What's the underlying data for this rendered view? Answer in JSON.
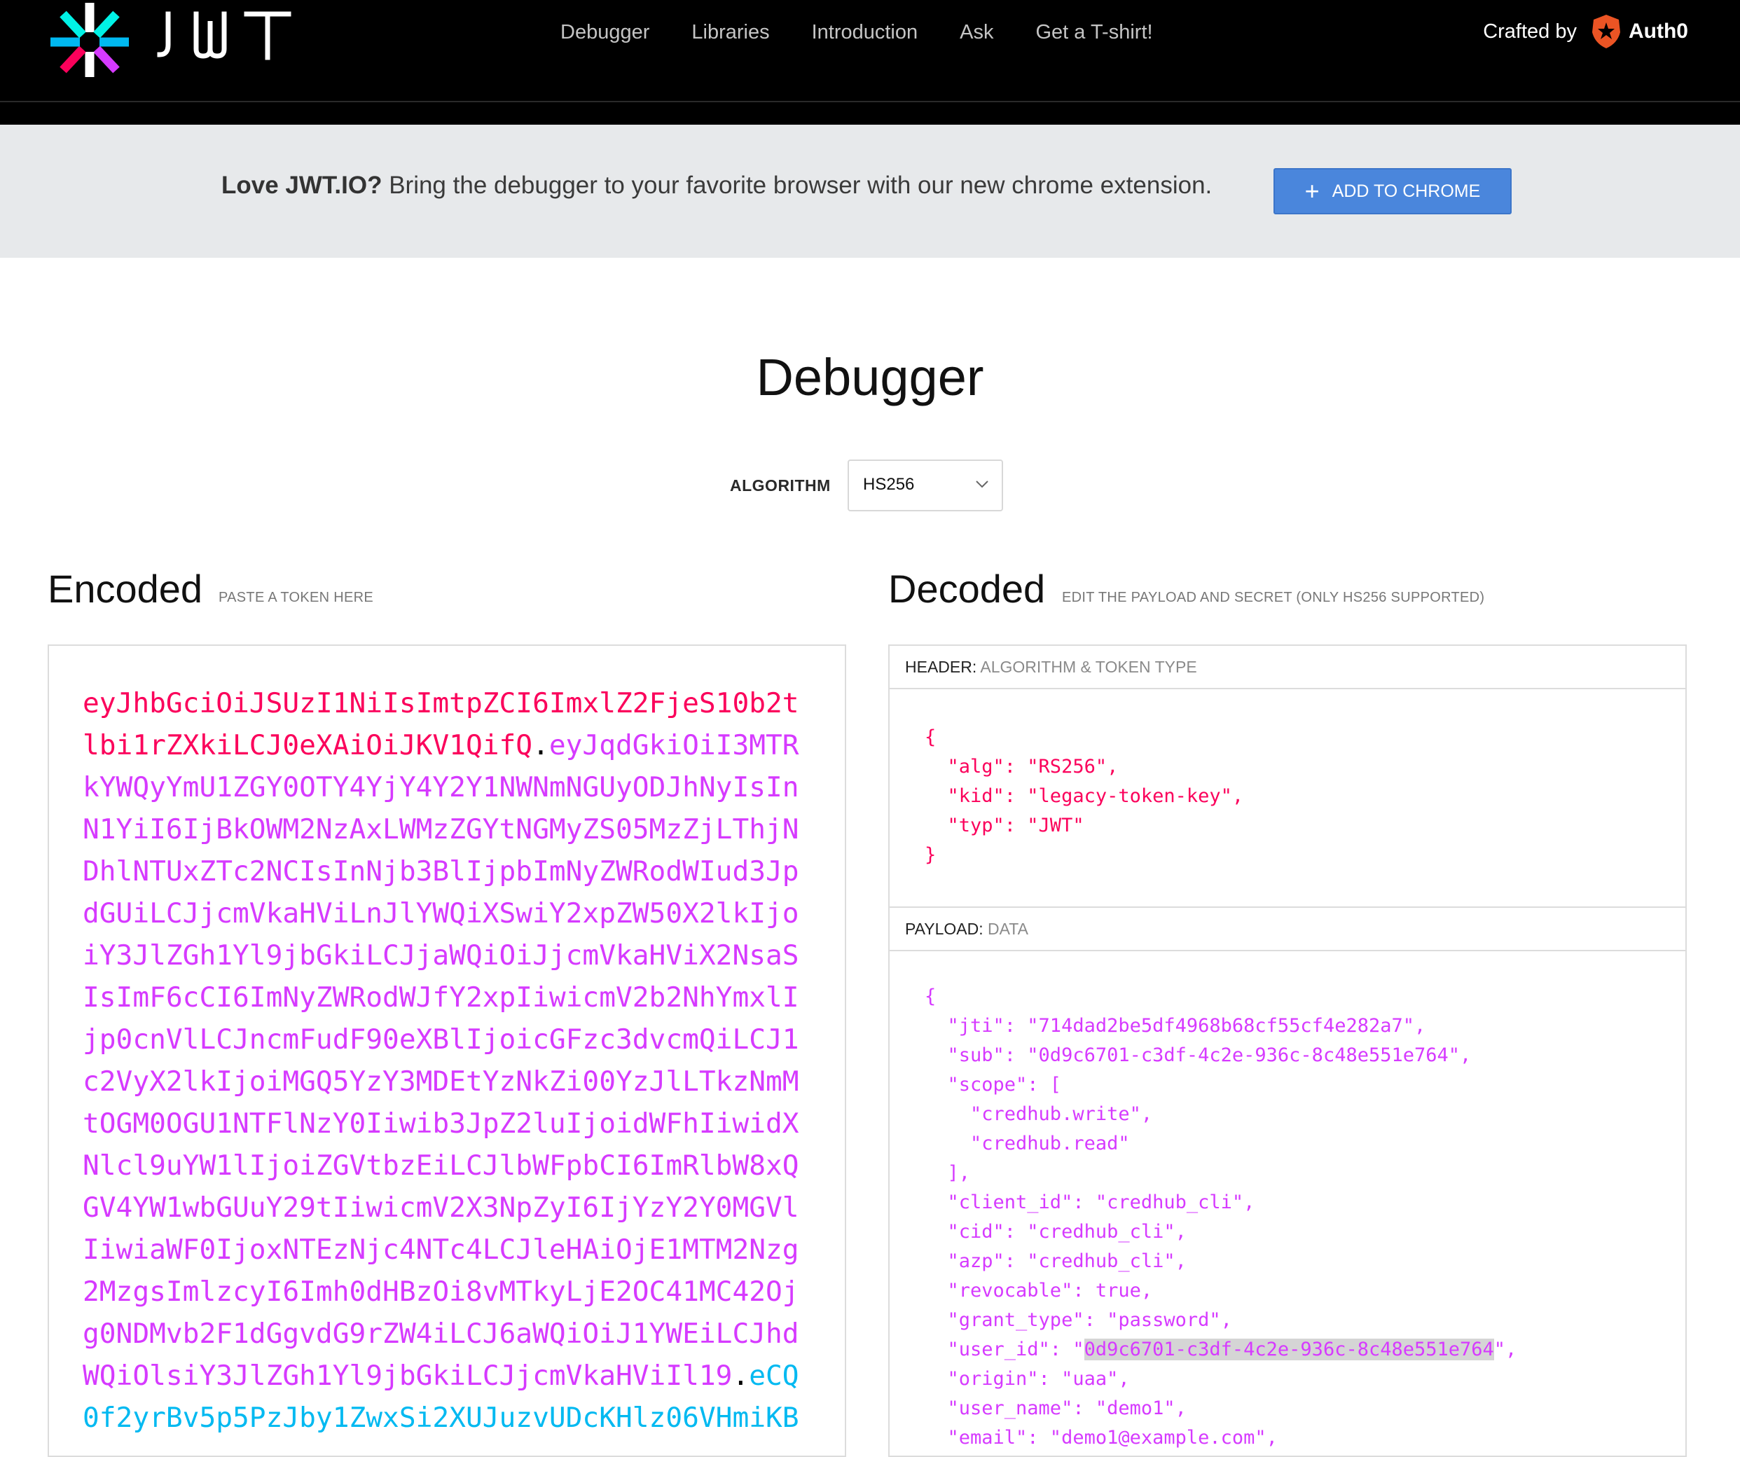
{
  "nav": {
    "brand": "JWT",
    "links": [
      "Debugger",
      "Libraries",
      "Introduction",
      "Ask",
      "Get a T-shirt!"
    ],
    "crafted_by": "Crafted by",
    "crafted_brand": "Auth0"
  },
  "banner": {
    "lead": "Love JWT.IO?",
    "text": " Bring the debugger to your favorite browser with our new chrome extension.",
    "button": "ADD TO CHROME",
    "button_icon": "plus-icon"
  },
  "page": {
    "title": "Debugger",
    "algorithm_label": "ALGORITHM",
    "algorithm_value": "HS256"
  },
  "encoded": {
    "title": "Encoded",
    "subtitle": "PASTE A TOKEN HERE",
    "header_part": "eyJhbGciOiJSUzI1NiIsImtpZCI6ImxlZ2FjeS10b2tlbi1rZXkiLCJ0eXAiOiJKV1QifQ",
    "payload_part": "eyJqdGkiOiI3MTRkYWQyYmU1ZGY0OTY4YjY4Y2Y1NWNmNGUyODJhNyIsInN1YiI6IjBkOWM2NzAxLWMzZGYtNGMyZS05MzZjLThjNDhlNTUxZTc2NCIsInNjb3BlIjpbImNyZWRodWIud3JpdGUiLCJjcmVkaHViLnJlYWQiXSwiY2xpZW50X2lkIjoiY3JlZGh1Yl9jbGkiLCJjaWQiOiJjcmVkaHViX2NsaSIsImF6cCI6ImNyZWRodWJfY2xpIiwicmV2b2NhYmxlIjp0cnVlLCJncmFudF90eXBlIjoicGFzc3dvcmQiLCJ1c2VyX2lkIjoiMGQ5YzY3MDEtYzNkZi00YzJlLTkzNmMtOGM0OGU1NTFlNzY0Iiwib3JpZ2luIjoidWFhIiwidXNlcl9uYW1lIjoiZGVtbzEiLCJlbWFpbCI6ImRlbW8xQGV4YW1wbGUuY29tIiwiaWF0IjoxNTEzNjc4NTc4LCJleHAiOjE1MTM2Nzg2MzgsImlzcyI6Imh0dHBzOi8vMTkyLjE2OC41MC42OjgwNDMvb2F1dGgvdG9rZW4iLCJ6aWQiOiJ1YWEiLCJhdWQiOlsiY3JlZGh1Yl9jbGkiLCJjcmVkaHViIl19",
    "signature_part": "eCQ0f2yrBv5p5PzJby1ZwxSi2XUJuzvUDcKHlz06VHmiKB",
    "lines": [
      [
        {
          "t": "eyJhbGciOiJSUzI1NiIsImtpZCI6ImxlZ2FjeS10b2t",
          "c": "h"
        }
      ],
      [
        {
          "t": "lbi1rZXkiLCJ0eXAiOiJKV1QifQ",
          "c": "h"
        },
        {
          "t": ".",
          "c": "d"
        },
        {
          "t": "eyJqdGkiOiI3MTR",
          "c": "p"
        }
      ],
      [
        {
          "t": "kYWQyYmU1ZGY0OTY4YjY4Y2Y1NWNmNGUyODJhNyIsIn",
          "c": "p"
        }
      ],
      [
        {
          "t": "N1YiI6IjBkOWM2NzAxLWMzZGYtNGMyZS05MzZjLThjN",
          "c": "p"
        }
      ],
      [
        {
          "t": "DhlNTUxZTc2NCIsInNjb3BlIjpbImNyZWRodWIud3Jp",
          "c": "p"
        }
      ],
      [
        {
          "t": "dGUiLCJjcmVkaHViLnJlYWQiXSwiY2xpZW50X2lkIjo",
          "c": "p"
        }
      ],
      [
        {
          "t": "iY3JlZGh1Yl9jbGkiLCJjaWQiOiJjcmVkaHViX2NsaS",
          "c": "p"
        }
      ],
      [
        {
          "t": "IsImF6cCI6ImNyZWRodWJfY2xpIiwicmV2b2NhYmxlI",
          "c": "p"
        }
      ],
      [
        {
          "t": "jp0cnVlLCJncmFudF90eXBlIjoicGFzc3dvcmQiLCJ1",
          "c": "p"
        }
      ],
      [
        {
          "t": "c2VyX2lkIjoiMGQ5YzY3MDEtYzNkZi00YzJlLTkzNmM",
          "c": "p"
        }
      ],
      [
        {
          "t": "tOGM0OGU1NTFlNzY0Iiwib3JpZ2luIjoidWFhIiwidX",
          "c": "p"
        }
      ],
      [
        {
          "t": "Nlcl9uYW1lIjoiZGVtbzEiLCJlbWFpbCI6ImRlbW8xQ",
          "c": "p"
        }
      ],
      [
        {
          "t": "GV4YW1wbGUuY29tIiwicmV2X3NpZyI6IjYzY2Y0MGVl",
          "c": "p"
        }
      ],
      [
        {
          "t": "IiwiaWF0IjoxNTEzNjc4NTc4LCJleHAiOjE1MTM2Nzg",
          "c": "p"
        }
      ],
      [
        {
          "t": "2MzgsImlzcyI6Imh0dHBzOi8vMTkyLjE2OC41MC42Oj",
          "c": "p"
        }
      ],
      [
        {
          "t": "g0NDMvb2F1dGgvdG9rZW4iLCJ6aWQiOiJ1YWEiLCJhd",
          "c": "p"
        }
      ],
      [
        {
          "t": "WQiOlsiY3JlZGh1Yl9jbGkiLCJjcmVkaHViIl19",
          "c": "p"
        },
        {
          "t": ".",
          "c": "d"
        },
        {
          "t": "eCQ",
          "c": "s"
        }
      ],
      [
        {
          "t": "0f2yrBv5p5PzJby1ZwxSi2XUJuzvUDcKHlz06VHmiKB",
          "c": "s"
        }
      ]
    ]
  },
  "decoded": {
    "title": "Decoded",
    "subtitle": "EDIT THE PAYLOAD AND SECRET (ONLY HS256 SUPPORTED)",
    "header_label": "HEADER:",
    "header_hint": "ALGORITHM & TOKEN TYPE",
    "payload_label": "PAYLOAD:",
    "payload_hint": "DATA",
    "header_lines": [
      "{",
      "  \"alg\": \"RS256\",",
      "  \"kid\": \"legacy-token-key\",",
      "  \"typ\": \"JWT\"",
      "}"
    ],
    "payload_lines": [
      "{",
      "  \"jti\": \"714dad2be5df4968b68cf55cf4e282a7\",",
      "  \"sub\": \"0d9c6701-c3df-4c2e-936c-8c48e551e764\",",
      "  \"scope\": [",
      "    \"credhub.write\",",
      "    \"credhub.read\"",
      "  ],",
      "  \"client_id\": \"credhub_cli\",",
      "  \"cid\": \"credhub_cli\",",
      "  \"azp\": \"credhub_cli\",",
      "  \"revocable\": true,",
      "  \"grant_type\": \"password\",",
      "  \"user_id\": \"0d9c6701-c3df-4c2e-936c-8c48e551e764\",",
      "  \"origin\": \"uaa\",",
      "  \"user_name\": \"demo1\",",
      "  \"email\": \"demo1@example.com\","
    ],
    "highlighted_value": "0d9c6701-c3df-4c2e-936c-8c48e551e764"
  },
  "colors": {
    "header": "#fb015b",
    "payload": "#d63aff",
    "signature": "#00b9f1",
    "button": "#4a86dc"
  }
}
